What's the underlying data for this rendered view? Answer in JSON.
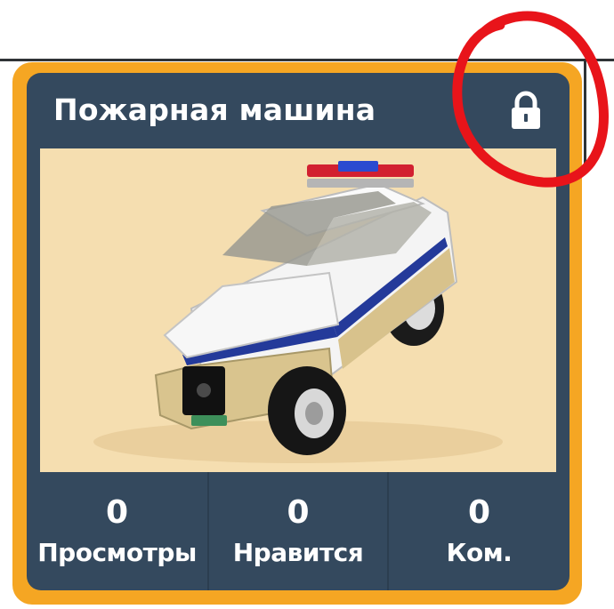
{
  "card": {
    "title": "Пожарная машина",
    "locked": true,
    "colors": {
      "border": "#f5a623",
      "background": "#34495e",
      "image_background": "#f5deb0",
      "text": "#ffffff",
      "annotation": "#e8141a"
    }
  },
  "stats": [
    {
      "value": "0",
      "label": "Просмотры"
    },
    {
      "value": "0",
      "label": "Нравится"
    },
    {
      "value": "0",
      "label": "Ком."
    }
  ],
  "icons": {
    "lock": "lock-icon"
  }
}
